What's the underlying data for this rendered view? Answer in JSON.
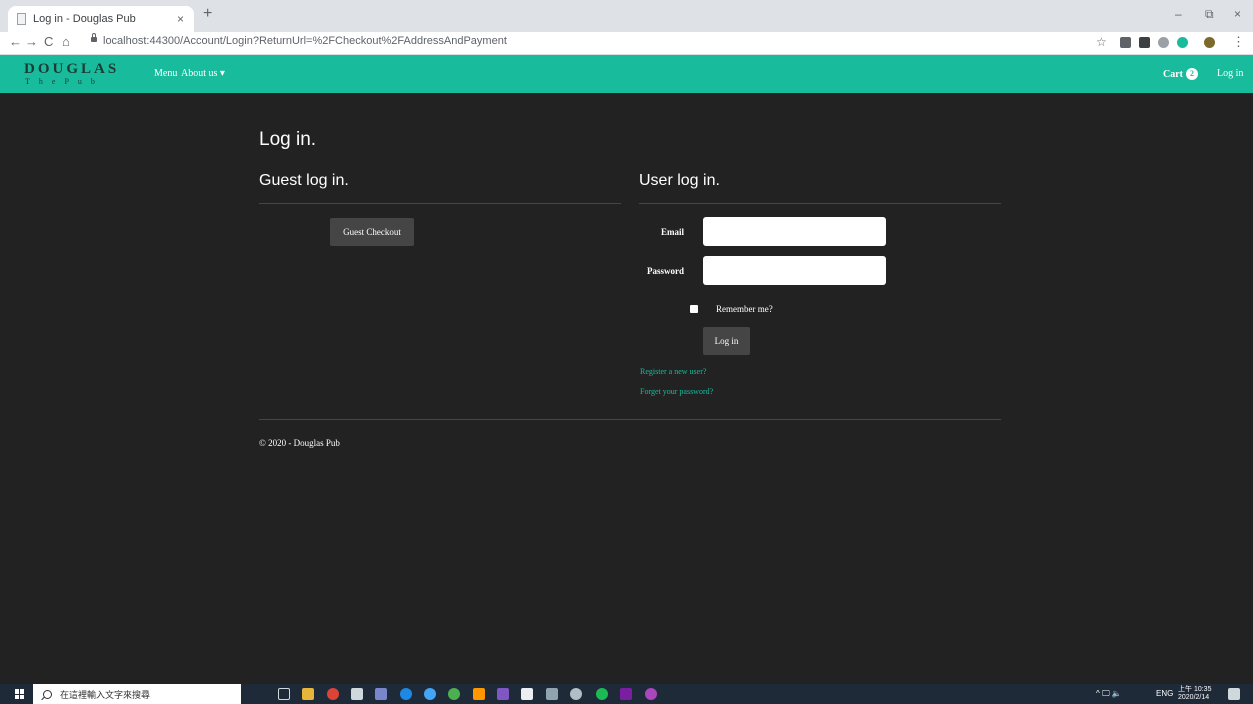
{
  "browser": {
    "tab_title": "Log in - Douglas Pub",
    "tab_close": "×",
    "new_tab": "+",
    "url": "localhost:44300/Account/Login?ReturnUrl=%2FCheckout%2FAddressAndPayment",
    "back": "←",
    "forward": "→",
    "reload": "C",
    "home": "⌂",
    "bookmark": "☆",
    "menu": "⋮",
    "minimize": "–",
    "restore": "⧉",
    "close": "×"
  },
  "nav": {
    "brand": "DOUGLAS",
    "brand_sub": "ThePub",
    "menu_link": "Menu",
    "about_link": "About us ▾",
    "cart_label": "Cart",
    "cart_count": "2",
    "login_link": "Log in",
    "color": "#18bc9c"
  },
  "page": {
    "title": "Log in.",
    "guest_heading": "Guest log in.",
    "guest_button": "Guest Checkout",
    "user_heading": "User log in.",
    "email_label": "Email",
    "email_value": "",
    "password_label": "Password",
    "password_value": "",
    "remember_label": "Remember me?",
    "login_button": "Log in",
    "register_link": "Register a new user?",
    "forgot_link": "Forget your password?",
    "footer": "© 2020 - Douglas Pub"
  },
  "taskbar": {
    "search_placeholder": "在這裡輸入文字來搜尋",
    "tray_lang": "ENG",
    "tray_time": "上午 10:35",
    "tray_date": "2020/2/14",
    "tray_misc": "^ 🖵 🔈"
  }
}
